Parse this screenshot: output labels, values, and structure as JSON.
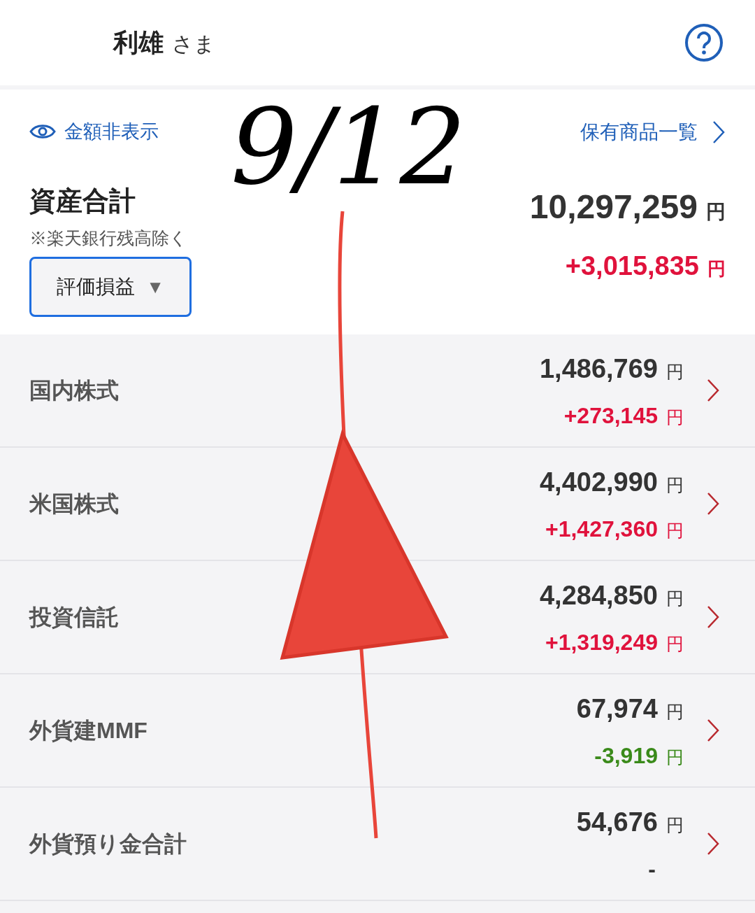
{
  "header": {
    "name": "利雄",
    "honorific": "さま"
  },
  "summary": {
    "hide_link": "金額非表示",
    "holdings_link": "保有商品一覧",
    "title": "資産合計",
    "note": "※楽天銀行残高除く",
    "dropdown": "評価損益",
    "dropdown_caret": "▼",
    "total": "10,297,259",
    "total_unit": "円",
    "gain": "+3,015,835",
    "gain_unit": "円"
  },
  "rows": [
    {
      "label": "国内株式",
      "value": "1,486,769",
      "unit": "円",
      "change": "+273,145",
      "change_unit": "円",
      "color": "#e0123c"
    },
    {
      "label": "米国株式",
      "value": "4,402,990",
      "unit": "円",
      "change": "+1,427,360",
      "change_unit": "円",
      "color": "#e0123c"
    },
    {
      "label": "投資信託",
      "value": "4,284,850",
      "unit": "円",
      "change": "+1,319,249",
      "change_unit": "円",
      "color": "#e0123c"
    },
    {
      "label": "外貨建MMF",
      "value": "67,974",
      "unit": "円",
      "change": "-3,919",
      "change_unit": "円",
      "color": "#3a8a1a"
    },
    {
      "label": "外貨預り金合計",
      "value": "54,676",
      "unit": "円",
      "change": "-",
      "color": "#333333"
    }
  ],
  "annotation": {
    "text": "9/12"
  }
}
